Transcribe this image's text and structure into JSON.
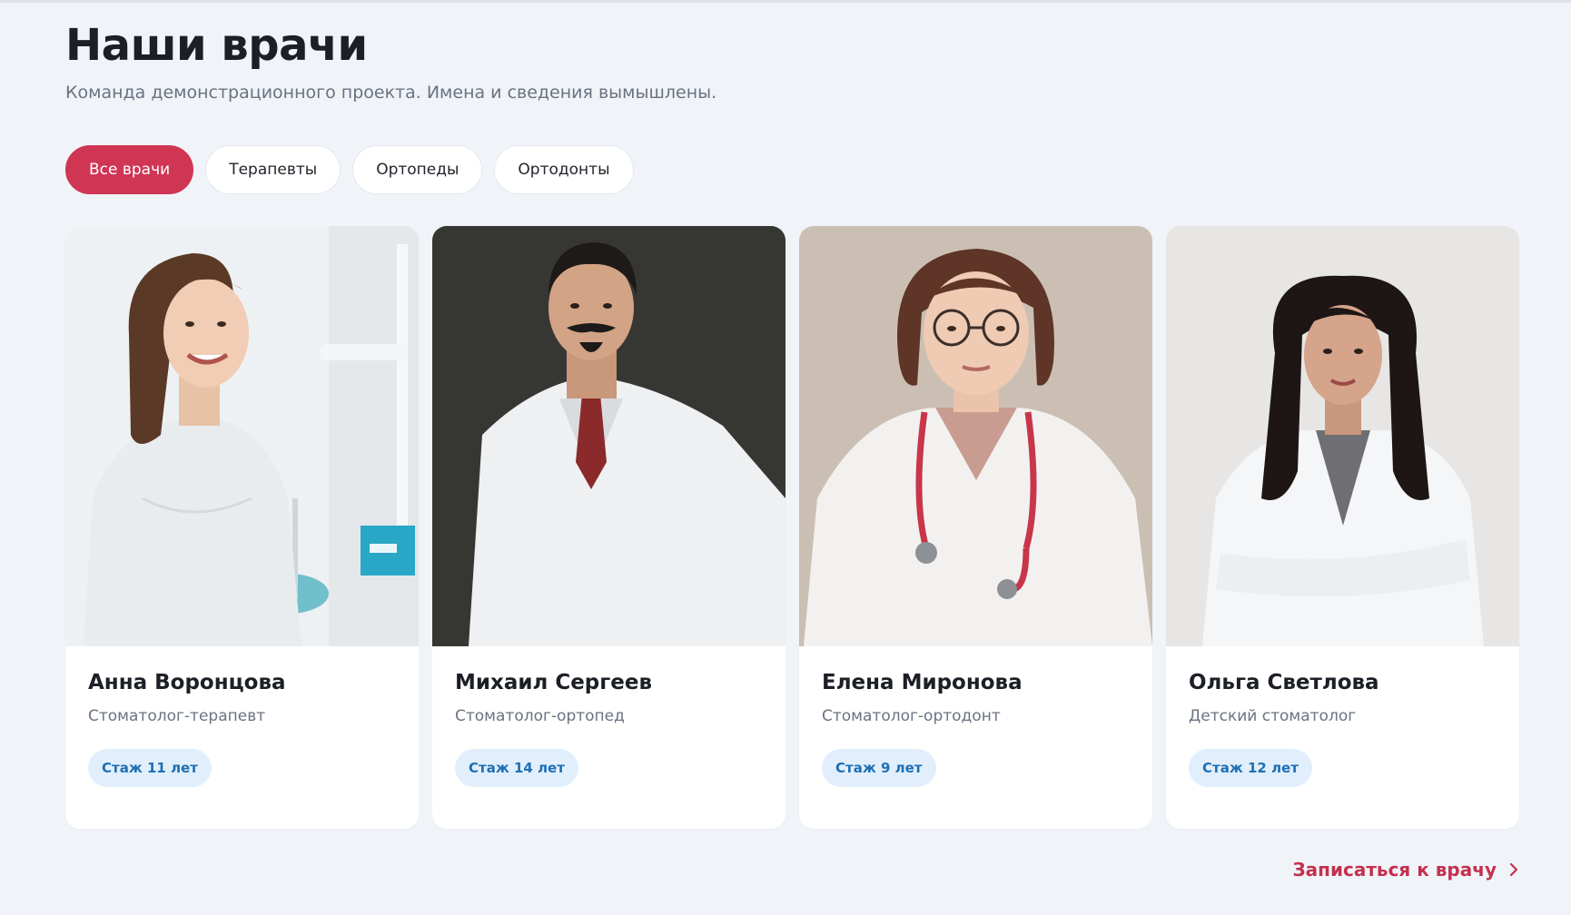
{
  "page": {
    "title": "Наши врачи",
    "subtitle": "Команда демонстрационного проекта. Имена и сведения вымышлены."
  },
  "filters": [
    {
      "label": "Все врачи",
      "active": true
    },
    {
      "label": "Терапевты",
      "active": false
    },
    {
      "label": "Ортопеды",
      "active": false
    },
    {
      "label": "Ортодонты",
      "active": false
    }
  ],
  "doctors": [
    {
      "name": "Анна Воронцова",
      "role": "Стоматолог-терапевт",
      "experience": "Стаж 11 лет"
    },
    {
      "name": "Михаил Сергеев",
      "role": "Стоматолог-ортопед",
      "experience": "Стаж 14 лет"
    },
    {
      "name": "Елена Миронова",
      "role": "Стоматолог-ортодонт",
      "experience": "Стаж 9 лет"
    },
    {
      "name": "Ольга Светлова",
      "role": "Детский стоматолог",
      "experience": "Стаж 12 лет"
    }
  ],
  "cta": {
    "label": "Записаться к врачу",
    "icon": "chevron-right-icon"
  },
  "colors": {
    "accent": "#d13554",
    "badge_bg": "#e1effc",
    "badge_text": "#1e6fb3",
    "page_bg": "#f0f4f8"
  }
}
